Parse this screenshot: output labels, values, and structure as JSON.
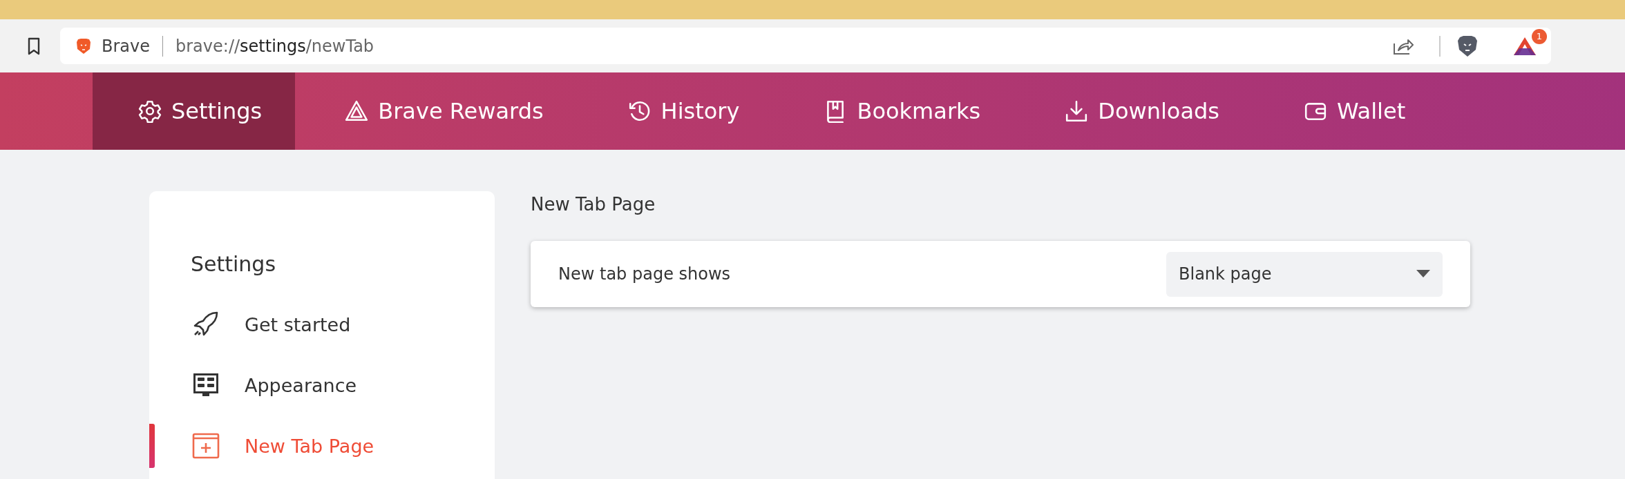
{
  "toolbar": {
    "site_label": "Brave",
    "url_prefix": "brave://",
    "url_host": "settings",
    "url_path": "/newTab",
    "rewards_badge": "1"
  },
  "nav_tabs": [
    {
      "label": "Settings",
      "kind": "gear",
      "selected": true
    },
    {
      "label": "Brave Rewards",
      "kind": "rewards",
      "selected": false
    },
    {
      "label": "History",
      "kind": "history",
      "selected": false
    },
    {
      "label": "Bookmarks",
      "kind": "bookmarks",
      "selected": false
    },
    {
      "label": "Downloads",
      "kind": "downloads",
      "selected": false
    },
    {
      "label": "Wallet",
      "kind": "wallet",
      "selected": false
    }
  ],
  "sidebar": {
    "title": "Settings",
    "items": [
      {
        "label": "Get started",
        "kind": "rocket",
        "selected": false
      },
      {
        "label": "Appearance",
        "kind": "appearance",
        "selected": false
      },
      {
        "label": "New Tab Page",
        "kind": "newtab",
        "selected": true
      }
    ]
  },
  "section": {
    "title": "New Tab Page",
    "rows": [
      {
        "label": "New tab page shows",
        "value": "Blank page"
      }
    ]
  }
}
